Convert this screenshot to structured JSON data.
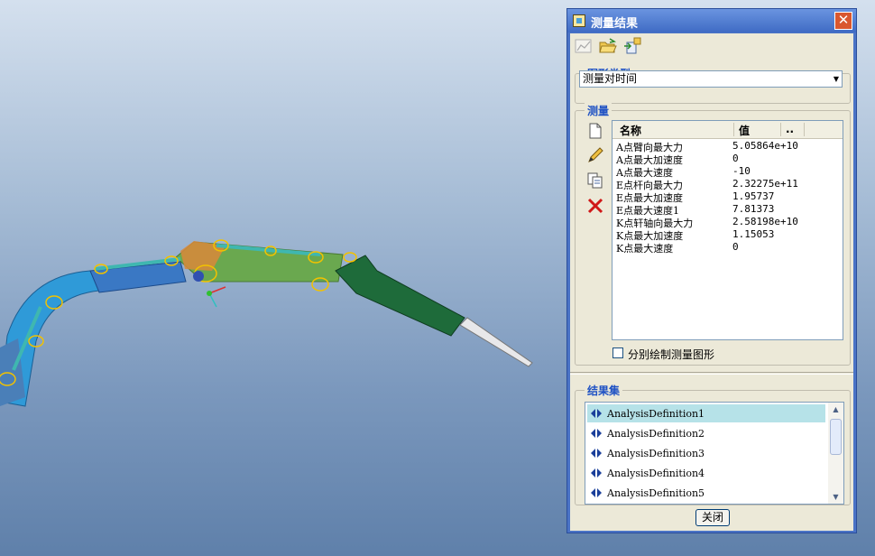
{
  "dialog": {
    "title": "测量结果",
    "close_glyph": "✕",
    "toolbar": [
      "graph-icon",
      "open-folder-icon",
      "export-icon"
    ],
    "graph_type": {
      "label": "图形类型",
      "selected": "测量对时间"
    },
    "measures": {
      "label": "测量",
      "side_icons": [
        "new-page-icon",
        "pencil-icon",
        "copy-icon",
        "delete-x-icon"
      ],
      "columns": [
        "名称",
        "值",
        ".."
      ],
      "rows": [
        {
          "name": "A点臂向最大力",
          "value": " 5.05864e+10"
        },
        {
          "name": "A点最大加速度",
          "value": "0"
        },
        {
          "name": "A点最大速度",
          "value": "-10"
        },
        {
          "name": "E点杆向最大力",
          "value": " 2.32275e+11"
        },
        {
          "name": "E点最大加速度",
          "value": "1.95737"
        },
        {
          "name": "E点最大速度1",
          "value": "7.81373"
        },
        {
          "name": "K点轩轴向最大力",
          "value": " 2.58198e+10"
        },
        {
          "name": "K点最大加速度",
          "value": "1.15053"
        },
        {
          "name": "K点最大速度",
          "value": "0"
        }
      ],
      "separate_plot_label": "分别绘制测量图形",
      "separate_plot_checked": false
    },
    "result_set": {
      "label": "结果集",
      "items": [
        "AnalysisDefinition1",
        "AnalysisDefinition2",
        "AnalysisDefinition3",
        "AnalysisDefinition4",
        "AnalysisDefinition5"
      ],
      "selected_index": 0
    },
    "close_button": "关闭"
  },
  "colors": {
    "title_bar": "#4a73c6",
    "selection": "#b6e2e8",
    "group_label": "#1f52c4",
    "arm_blue": "#2f9ad8",
    "arm_green": "#6aa84f",
    "hammer_green": "#1e6b3a"
  }
}
